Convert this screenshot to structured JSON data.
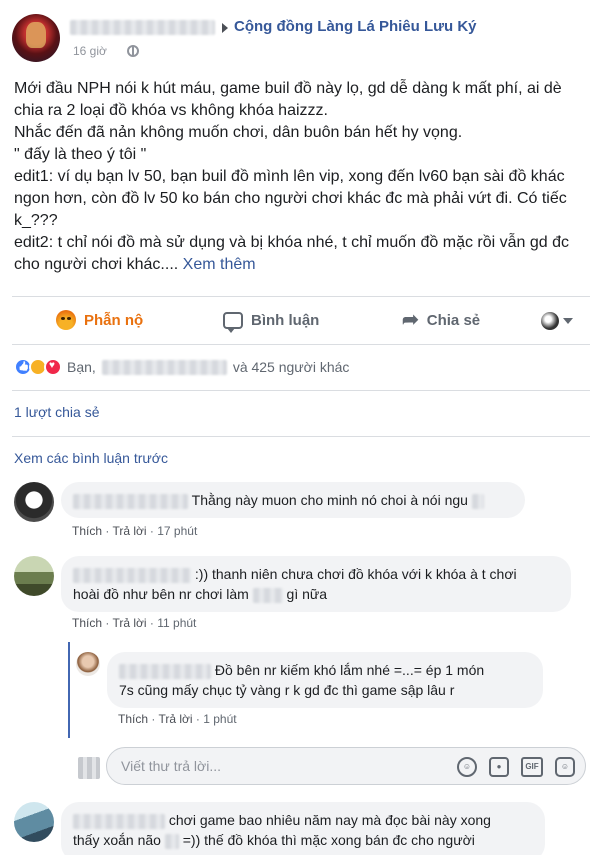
{
  "post": {
    "group_name": "Cộng đồng Làng Lá Phiêu Lưu Ký",
    "time": "16 giờ",
    "paragraphs": [
      "Mới đầu NPH nói k hút máu, game buil đồ này lọ, gd dễ dàng k mất phí, ai dè chia ra 2 loại đồ khóa vs không khóa haizzz.",
      "Nhắc đến đã nản không muốn chơi, dân buôn bán hết hy vọng.",
      "\" đấy là theo ý tôi \"",
      "edit1: ví dụ bạn lv 50, bạn buil đồ mình lên vip, xong đến lv60 bạn sài đồ khác ngon hơn, còn đồ lv 50 ko bán cho người chơi khác đc mà phải vứt đi. Có tiếc k_???"
    ],
    "last_paragraph": "edit2: t chỉ nói đồ mà sử dụng và bị khóa nhé, t chỉ muốn đồ mặc rồi vẫn gd đc cho người chơi khác....",
    "see_more": "Xem thêm"
  },
  "actions": {
    "react": "Phẫn nộ",
    "comment": "Bình luận",
    "share": "Chia sẻ"
  },
  "summary": {
    "reactions_prefix": "Bạn,",
    "reactions_suffix": "và 425 người khác",
    "shares": "1 lượt chia sẻ",
    "view_previous": "Xem các bình luận trước"
  },
  "comments": [
    {
      "text": "Thằng này muon cho minh nó choi à nói ngu",
      "like": "Thích",
      "reply": "Trả lời",
      "time": "17 phút"
    },
    {
      "text_line1": ":)) thanh niên chưa chơi đồ khóa với k khóa à t chơi",
      "text_line2_a": "hoài đồ như bên nr chơi làm",
      "text_line2_b": "gì nữa",
      "like": "Thích",
      "reply": "Trả lời",
      "time": "11 phút"
    },
    {
      "text_line1": "Đồ bên nr kiếm khó lắm nhé =...= ép 1 món",
      "text_line2": "7s cũng mấy chục tỷ vàng r k gd đc thì game sập lâu r",
      "like": "Thích",
      "reply": "Trả lời",
      "time": "1 phút"
    },
    {
      "text_line1": "chơi game bao nhiêu năm nay mà đọc bài này xong",
      "text_line2_a": "thấy xoắn não",
      "text_line2_b": "=)) thế đồ khóa thì mặc xong bán đc cho người"
    }
  ],
  "reply_box": {
    "placeholder": "Viết thư trả lời..."
  },
  "colors": {
    "link": "#365899",
    "react_active": "#e9710f",
    "muted": "#606770",
    "bubble": "#f2f3f5",
    "thread_line": "#4267b2"
  },
  "icons": {
    "privacy": "globe-icon",
    "react": "angry-icon",
    "comment": "comment-icon",
    "share": "share-icon",
    "reactions": [
      "like-icon",
      "haha-icon",
      "love-icon"
    ],
    "reply_tools": [
      "emoji-icon",
      "camera-icon",
      "gif-icon",
      "sticker-icon"
    ]
  }
}
